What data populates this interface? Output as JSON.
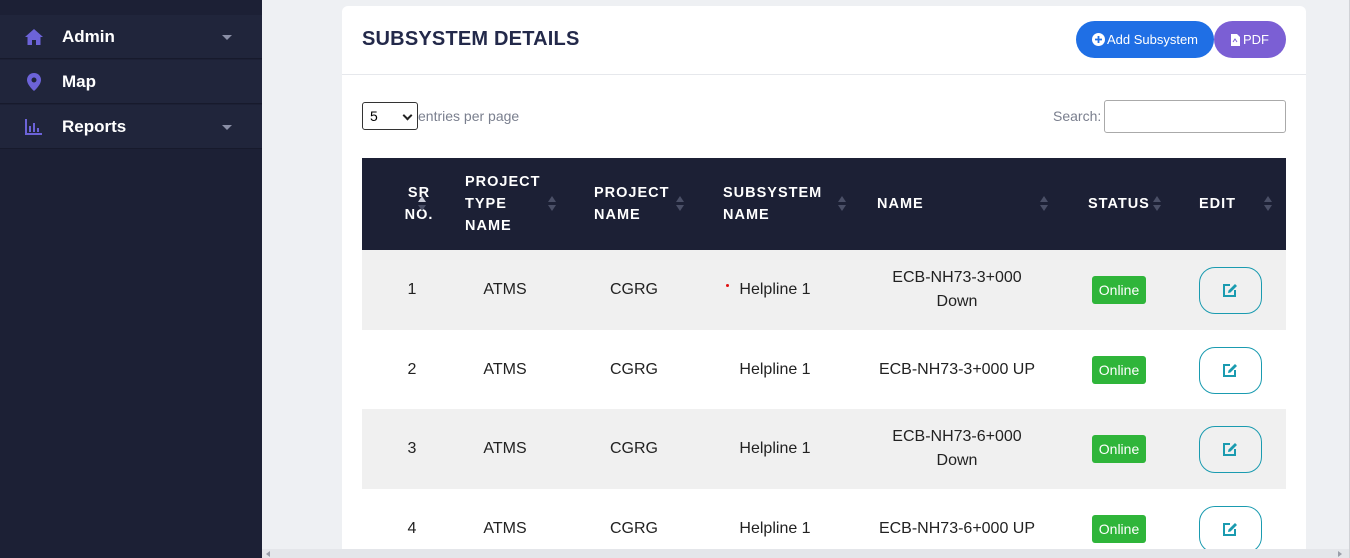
{
  "sidebar": {
    "items": [
      {
        "label": "Admin",
        "icon": "home-icon",
        "has_dropdown": true
      },
      {
        "label": "Map",
        "icon": "map-pin-icon",
        "has_dropdown": false
      },
      {
        "label": "Reports",
        "icon": "chart-icon",
        "has_dropdown": true
      }
    ]
  },
  "header": {
    "title": "SUBSYSTEM DETAILS",
    "add_button_label": "Add Subsystem",
    "pdf_button_label": "PDF"
  },
  "controls": {
    "entries_value": "5",
    "entries_label": "entries per page",
    "search_label": "Search:",
    "search_value": ""
  },
  "table": {
    "columns": [
      {
        "label": "SR NO.",
        "lines": [
          "SR",
          "NO."
        ]
      },
      {
        "label": "PROJECT TYPE NAME",
        "lines": [
          "PROJECT",
          "TYPE",
          "NAME"
        ]
      },
      {
        "label": "PROJECT NAME",
        "lines": [
          "PROJECT",
          "NAME"
        ]
      },
      {
        "label": "SUBSYSTEM NAME",
        "lines": [
          "SUBSYSTEM",
          "NAME"
        ]
      },
      {
        "label": "NAME",
        "lines": [
          "NAME"
        ]
      },
      {
        "label": "STATUS",
        "lines": [
          "STATUS"
        ]
      },
      {
        "label": "EDIT",
        "lines": [
          "EDIT"
        ]
      }
    ],
    "rows": [
      {
        "sr": "1",
        "project_type": "ATMS",
        "project_name": "CGRG",
        "subsystem": "Helpline 1",
        "name_lines": [
          "ECB-NH73-3+000",
          "Down"
        ],
        "status": "Online"
      },
      {
        "sr": "2",
        "project_type": "ATMS",
        "project_name": "CGRG",
        "subsystem": "Helpline 1",
        "name_lines": [
          "ECB-NH73-3+000 UP"
        ],
        "status": "Online"
      },
      {
        "sr": "3",
        "project_type": "ATMS",
        "project_name": "CGRG",
        "subsystem": "Helpline 1",
        "name_lines": [
          "ECB-NH73-6+000",
          "Down"
        ],
        "status": "Online"
      },
      {
        "sr": "4",
        "project_type": "ATMS",
        "project_name": "CGRG",
        "subsystem": "Helpline 1",
        "name_lines": [
          "ECB-NH73-6+000 UP"
        ],
        "status": "Online"
      }
    ]
  },
  "colors": {
    "sidebar_bg": "#1c2035",
    "table_header_bg": "#1c2035",
    "add_button": "#1f6fe5",
    "pdf_button": "#7b5fd4",
    "status_online": "#2fb53a",
    "edit_border": "#1a9bb0",
    "sidebar_icon": "#6c63d8"
  }
}
